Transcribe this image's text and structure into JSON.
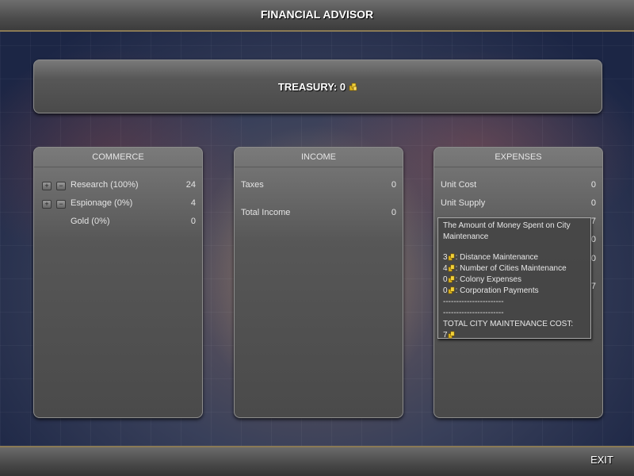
{
  "header": {
    "title": "FINANCIAL ADVISOR"
  },
  "treasury": {
    "label": "TREASURY: 0",
    "icon": "gold-coin-icon"
  },
  "commerce": {
    "title": "COMMERCE",
    "rows": [
      {
        "label": "Research (100%)",
        "value": "24"
      },
      {
        "label": "Espionage (0%)",
        "value": "4"
      },
      {
        "label": "Gold (0%)",
        "value": "0"
      }
    ],
    "increase_symbol": "+",
    "decrease_symbol": "−"
  },
  "income": {
    "title": "INCOME",
    "rows": [
      {
        "label": "Taxes",
        "value": "0"
      },
      {
        "label": "Total Income",
        "value": "0"
      }
    ]
  },
  "expenses": {
    "title": "EXPENSES",
    "rows": [
      {
        "label": "Unit Cost",
        "value": "0"
      },
      {
        "label": "Unit Supply",
        "value": "0"
      }
    ],
    "hidden_values": [
      "7",
      "0",
      "0",
      "7"
    ]
  },
  "tooltip": {
    "heading": "The Amount of Money Spent on City Maintenance",
    "lines": [
      {
        "amount": "3",
        "text": ": Distance Maintenance"
      },
      {
        "amount": "4",
        "text": ": Number of Cities Maintenance"
      },
      {
        "amount": "0",
        "text": ": Colony Expenses"
      },
      {
        "amount": "0",
        "text": ": Corporation Payments"
      }
    ],
    "separator1": "-----------------------",
    "separator2": "-----------------------",
    "total_label": "TOTAL CITY MAINTENANCE COST:",
    "total_value": "7"
  },
  "footer": {
    "exit_label": "EXIT"
  },
  "colors": {
    "accent": "#8a7a55",
    "coin": "#f2d23a",
    "panel": "#575757"
  }
}
